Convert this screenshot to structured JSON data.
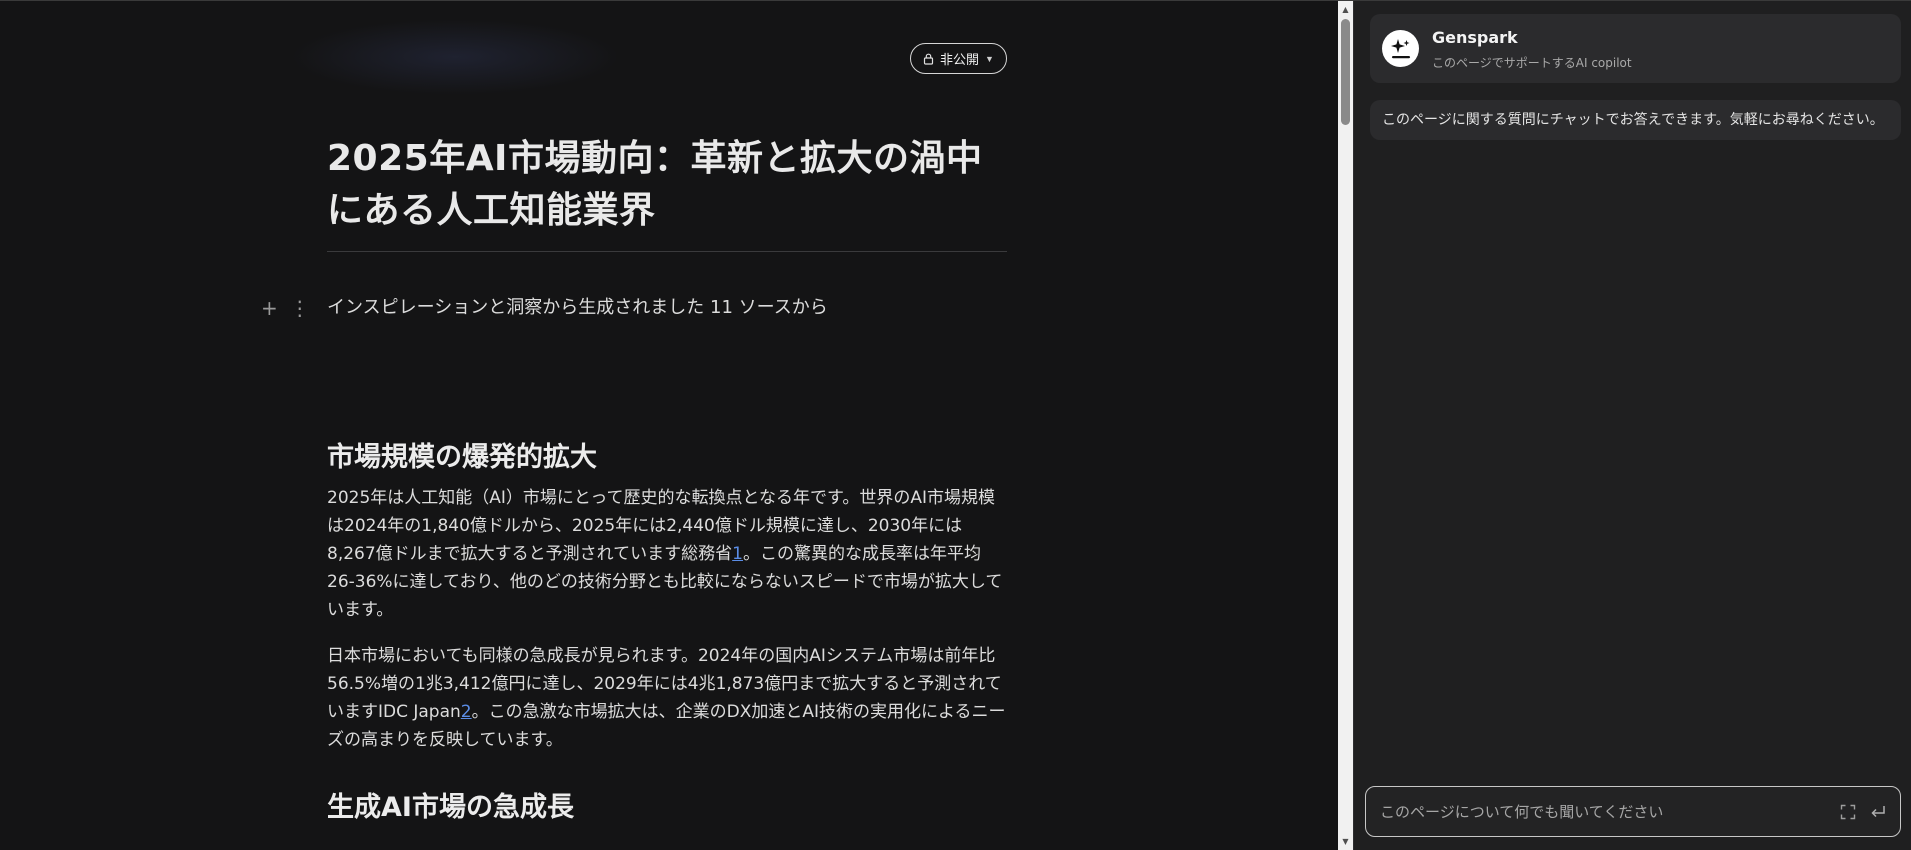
{
  "document": {
    "privacy_button": {
      "label": "非公開",
      "lock_icon": "lock-icon",
      "caret_icon": "chevron-down-icon"
    },
    "title": "2025年AI市場動向：革新と拡大の渦中にある人工知能業界",
    "subtitle": "インスピレーションと洞察から生成されました 11 ソースから",
    "block_controls": {
      "add_icon": "plus-icon",
      "drag_icon": "vertical-dots-icon"
    },
    "sections": [
      {
        "heading": "市場規模の爆発的拡大",
        "paragraphs": [
          {
            "before": "2025年は人工知能（AI）市場にとって歴史的な転換点となる年です。世界のAI市場規模は2024年の1,840億ドルから、2025年には2,440億ドル規模に達し、2030年には8,267億ドルまで拡大すると予測されています総務省",
            "cite": "1",
            "after": "。この驚異的な成長率は年平均26-36%に達しており、他のどの技術分野とも比較にならないスピードで市場が拡大しています。"
          },
          {
            "before": "日本市場においても同様の急成長が見られます。2024年の国内AIシステム市場は前年比56.5%増の1兆3,412億円に達し、2029年には4兆1,873億円まで拡大すると予測されていますIDC Japan",
            "cite": "2",
            "after": "。この急激な市場拡大は、企業のDX加速とAI技術の実用化によるニーズの高まりを反映しています。"
          }
        ]
      },
      {
        "heading": "生成AI市場の急成長",
        "paragraphs": []
      }
    ]
  },
  "copilot": {
    "brand": "Genspark",
    "tagline": "このページでサポートするAI copilot",
    "logo_icon": "sparkle-icon",
    "welcome": "このページに関する質問にチャットでお答えできます。気軽にお尋ねください。",
    "input_placeholder": "このページについて何でも聞いてください",
    "expand_icon": "expand-icon",
    "send_icon": "enter-icon"
  },
  "colors": {
    "background": "#141415",
    "panel": "#1f1f20",
    "card": "#2b2b2d",
    "link": "#5b8de6"
  }
}
